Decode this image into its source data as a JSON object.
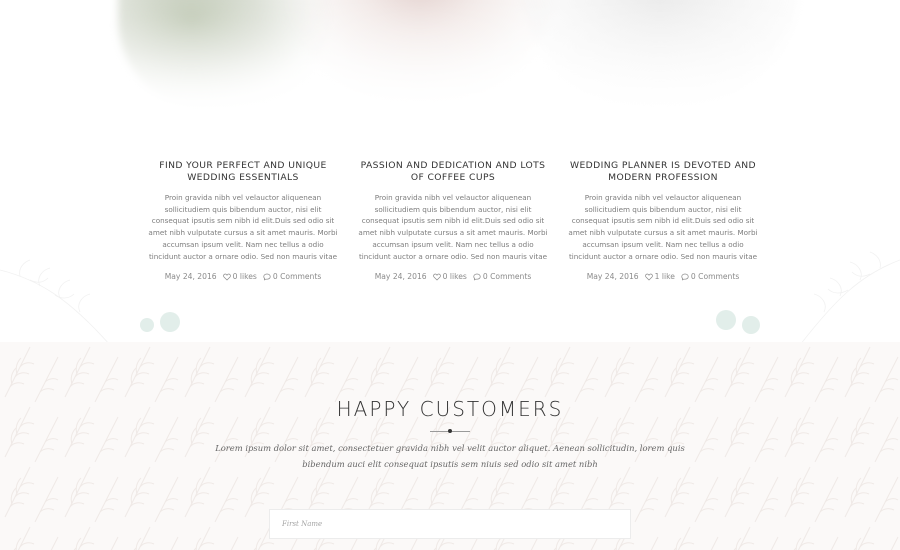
{
  "posts": [
    {
      "title": "FIND YOUR PERFECT AND UNIQUE WEDDING ESSENTIALS",
      "excerpt": "Proin gravida nibh vel velauctor aliquenean sollicitudiem quis bibendum auctor, nisi elit consequat ipsutis sem nibh id elit.Duis sed odio sit amet nibh vulputate cursus a sit amet mauris. Morbi accumsan ipsum velit. Nam nec tellus a odio tincidunt auctor a ornare odio. Sed non mauris vitae",
      "date": "May 24, 2016",
      "likes": "0 likes",
      "comments": "0 Comments"
    },
    {
      "title": "PASSION AND DEDICATION AND LOTS OF COFFEE CUPS",
      "excerpt": "Proin gravida nibh vel velauctor aliquenean sollicitudiem quis bibendum auctor, nisi elit consequat ipsutis sem nibh id elit.Duis sed odio sit amet nibh vulputate cursus a sit amet mauris. Morbi accumsan ipsum velit. Nam nec tellus a odio tincidunt auctor a ornare odio. Sed non mauris vitae",
      "date": "May 24, 2016",
      "likes": "0 likes",
      "comments": "0 Comments"
    },
    {
      "title": "WEDDING PLANNER IS DEVOTED AND MODERN PROFESSION",
      "excerpt": "Proin gravida nibh vel velauctor aliquenean sollicitudiem quis bibendum auctor, nisi elit consequat ipsutis sem nibh id elit.Duis sed odio sit amet nibh vulputate cursus a sit amet mauris. Morbi accumsan ipsum velit. Nam nec tellus a odio tincidunt auctor a ornare odio. Sed non mauris vitae",
      "date": "May 24, 2016",
      "likes": "1 like",
      "comments": "0 Comments"
    }
  ],
  "customers": {
    "title": "HAPPY CUSTOMERS",
    "intro": "Lorem ipsum dolor sit amet, consectetuer gravida nibh vel velit auctor aliquet. Aenean sollicitudin, lorem quis bibendum auci elit consequat ipsutis sem niuis sed odio sit amet nibh",
    "first_name_placeholder": "First Name"
  },
  "icons": {
    "like": "heart-icon",
    "comment": "comment-bubble-icon"
  },
  "colors": {
    "heading": "#333333",
    "body_text": "#7d7d7d",
    "section_bg": "#fbf9f8",
    "accent_dot": "#e2eeea"
  }
}
